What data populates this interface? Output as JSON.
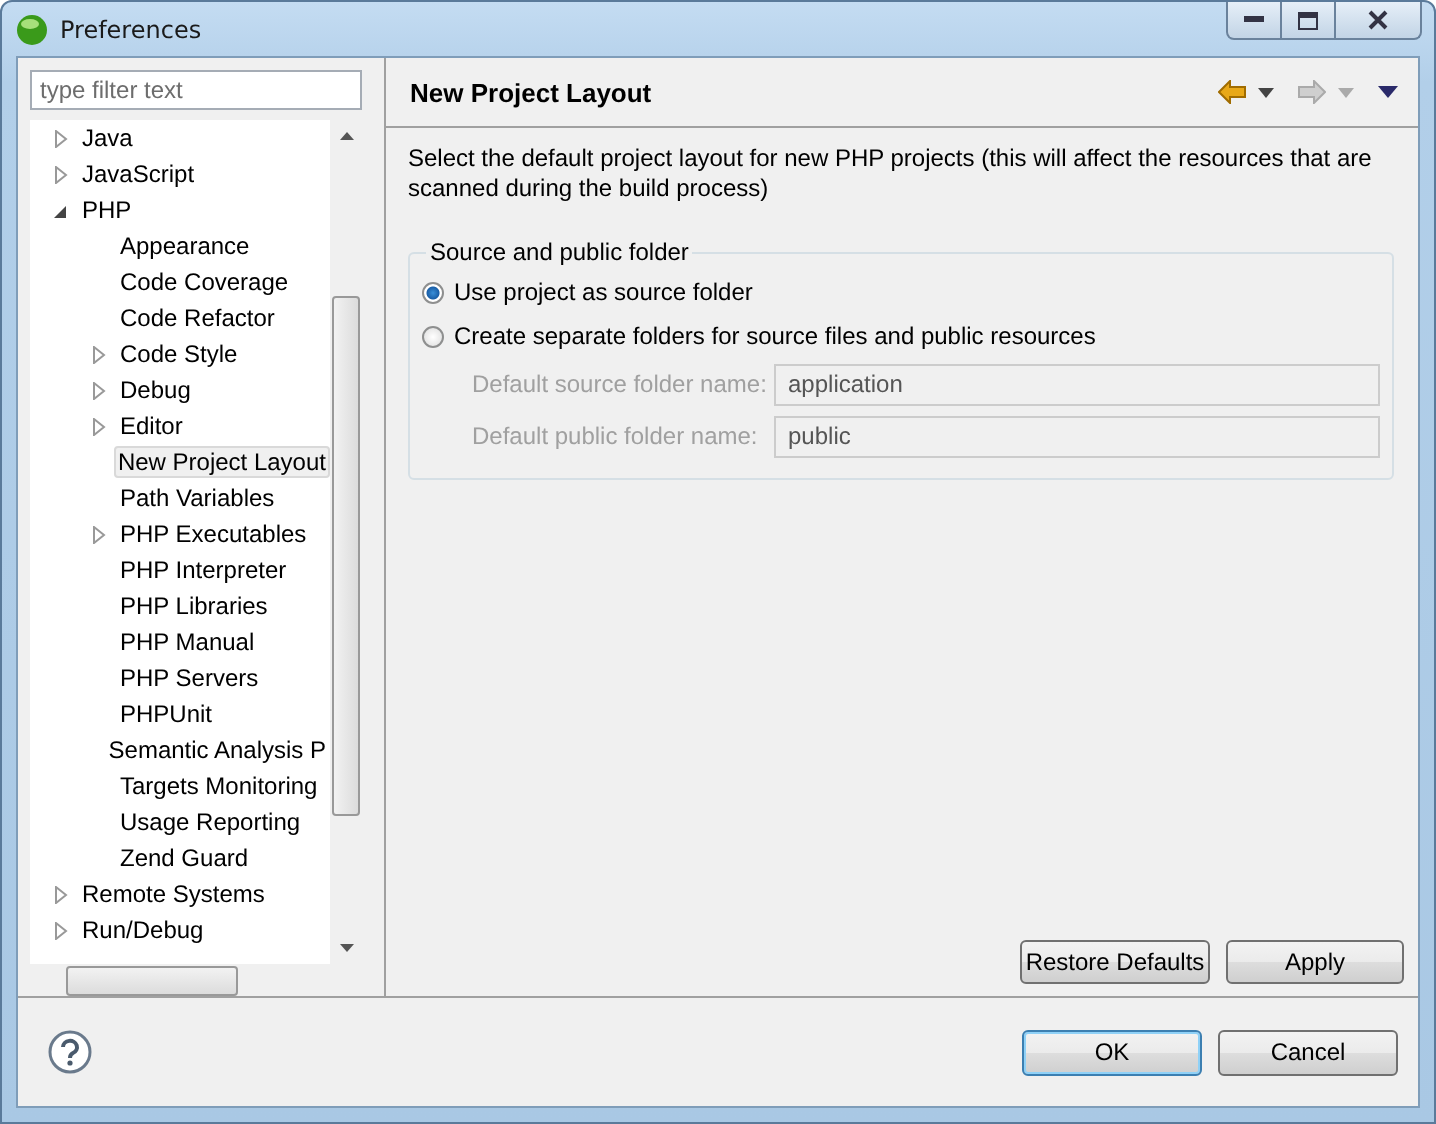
{
  "window": {
    "title": "Preferences"
  },
  "filter": {
    "placeholder": "type filter text"
  },
  "tree": [
    {
      "label": "Java",
      "expanded": false,
      "selected": false
    },
    {
      "label": "JavaScript",
      "expanded": false,
      "selected": false
    },
    {
      "label": "PHP",
      "expanded": true,
      "selected": false,
      "children": [
        {
          "label": "Appearance",
          "selected": false
        },
        {
          "label": "Code Coverage",
          "selected": false
        },
        {
          "label": "Code Refactor",
          "selected": false
        },
        {
          "label": "Code Style",
          "expanded": false,
          "selected": false
        },
        {
          "label": "Debug",
          "expanded": false,
          "selected": false
        },
        {
          "label": "Editor",
          "expanded": false,
          "selected": false
        },
        {
          "label": "New Project Layout",
          "selected": true
        },
        {
          "label": "Path Variables",
          "selected": false
        },
        {
          "label": "PHP Executables",
          "expanded": false,
          "selected": false
        },
        {
          "label": "PHP Interpreter",
          "selected": false
        },
        {
          "label": "PHP Libraries",
          "selected": false
        },
        {
          "label": "PHP Manual",
          "selected": false
        },
        {
          "label": "PHP Servers",
          "selected": false
        },
        {
          "label": "PHPUnit",
          "selected": false
        },
        {
          "label": "Semantic Analysis P",
          "selected": false
        },
        {
          "label": "Targets Monitoring",
          "selected": false
        },
        {
          "label": "Usage Reporting",
          "selected": false
        },
        {
          "label": "Zend Guard",
          "selected": false
        }
      ]
    },
    {
      "label": "Remote Systems",
      "expanded": false,
      "selected": false
    },
    {
      "label": "Run/Debug",
      "expanded": false,
      "selected": false
    }
  ],
  "page": {
    "title": "New Project Layout",
    "nav": [
      {
        "kind": "back",
        "disabled": false
      },
      {
        "kind": "forward",
        "disabled": true
      },
      {
        "kind": "menu",
        "disabled": false
      }
    ],
    "description": "Select the default project layout for new PHP projects (this will affect the resources that are scanned during the build process)",
    "group": {
      "legend": "Source and public folder",
      "options": [
        {
          "label": "Use project as source folder",
          "selected": true
        },
        {
          "label": "Create separate folders for source files and public resources",
          "selected": false
        }
      ],
      "fields": [
        {
          "label": "Default source folder name:",
          "value": "application",
          "disabled": true
        },
        {
          "label": "Default public folder name:",
          "value": "public",
          "disabled": true
        }
      ]
    },
    "buttons": [
      "Restore Defaults",
      "Apply"
    ]
  },
  "dialog_buttons": [
    {
      "label": "OK",
      "default": true
    },
    {
      "label": "Cancel",
      "default": false
    }
  ]
}
